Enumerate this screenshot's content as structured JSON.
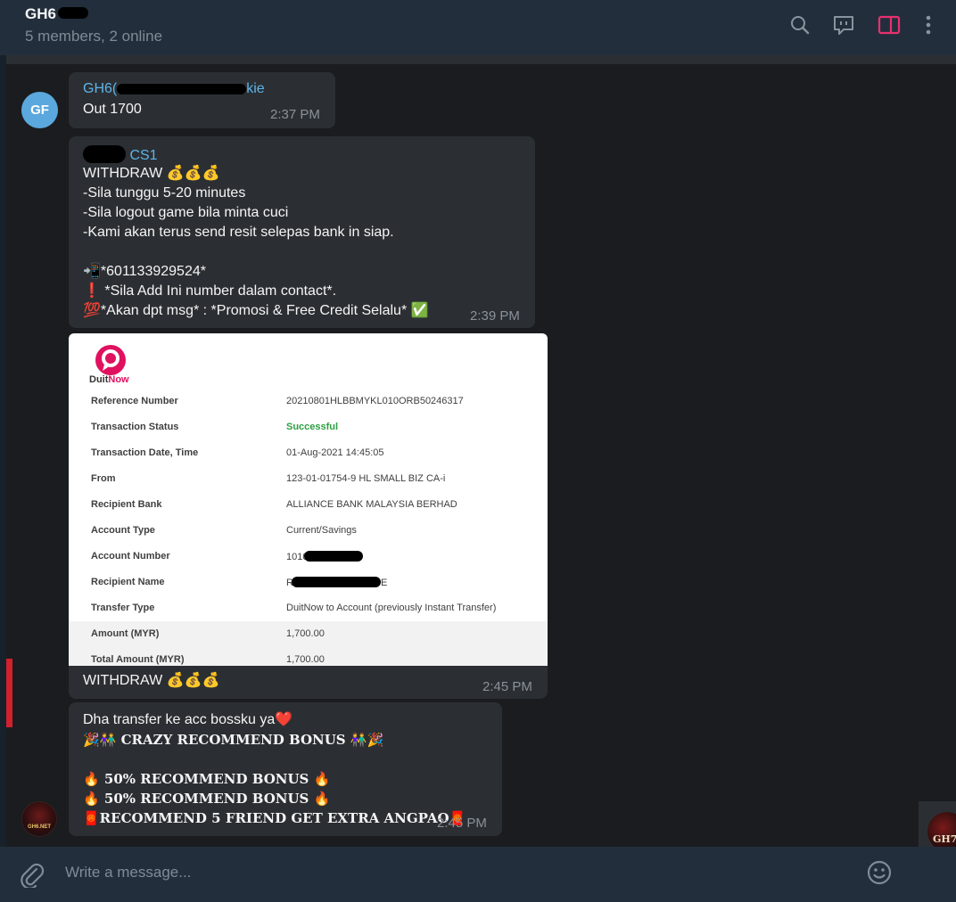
{
  "header": {
    "title": "GH6",
    "subtitle": "5 members, 2 online"
  },
  "messages": [
    {
      "avatar": "GF",
      "sender": "GH6(",
      "sender_suffix": "kie",
      "text": "Out 1700",
      "time": "2:37 PM"
    },
    {
      "sender": "CS1",
      "lines": [
        "WITHDRAW 💰💰💰",
        "-Sila tunggu 5-20 minutes",
        "-Sila logout game bila minta cuci",
        "-Kami akan terus send resit selepas bank in siap.",
        "",
        "📲*601133929524*",
        "❗ *Sila Add Ini number dalam contact*.",
        "💯*Akan dpt msg* : *Promosi & Free Credit Selalu* ✅"
      ],
      "time": "2:39 PM"
    },
    {
      "receipt": {
        "brand": "DuitNow",
        "brand_color": "#e0115f",
        "rows": [
          {
            "label": "Reference Number",
            "value": "20210801HLBBMYKL010ORB50246317"
          },
          {
            "label": "Transaction Status",
            "value": "Successful"
          },
          {
            "label": "Transaction Date, Time",
            "value": "01-Aug-2021 14:45:05"
          },
          {
            "label": "From",
            "value": "123-01-01754-9 HL SMALL BIZ CA-i"
          },
          {
            "label": "Recipient Bank",
            "value": "ALLIANCE BANK MALAYSIA BERHAD"
          },
          {
            "label": "Account Type",
            "value": "Current/Savings"
          },
          {
            "label": "Account Number",
            "value": "1010"
          },
          {
            "label": "Recipient Name",
            "value": "R",
            "value_suffix": "E"
          },
          {
            "label": "Transfer Type",
            "value": "DuitNow to Account (previously Instant Transfer)"
          },
          {
            "label": "Amount (MYR)",
            "value": "1,700.00"
          },
          {
            "label": "Total Amount (MYR)",
            "value": "1,700.00"
          }
        ]
      },
      "caption": "WITHDRAW 💰💰💰",
      "time": "2:45 PM"
    },
    {
      "lines": [
        "Dha transfer ke acc bossku ya❤️",
        "🎉👫 CRAZY RECOMMEND BONUS 👫🎉",
        "",
        "🔥 50% RECOMMEND BONUS 🔥",
        "🔥 50% RECOMMEND BONUS 🔥",
        "🧧RECOMMEND 5 FRIEND GET EXTRA ANGPAO🧧"
      ],
      "avatar_label": "GH6.NET",
      "time": "2:45 PM"
    }
  ],
  "composer": {
    "placeholder": "Write a message..."
  },
  "side_thumb_label": "GH7",
  "icons": {
    "search": "search-icon",
    "chat": "discussion-icon",
    "panel": "sidebar-panel-icon",
    "more": "more-vertical-icon",
    "attach": "paperclip-icon",
    "emoji": "emoji-icon"
  },
  "colors": {
    "accent_blue": "#5fb3e8",
    "accent_pink": "#e8306f",
    "success_green": "#2ea043"
  }
}
